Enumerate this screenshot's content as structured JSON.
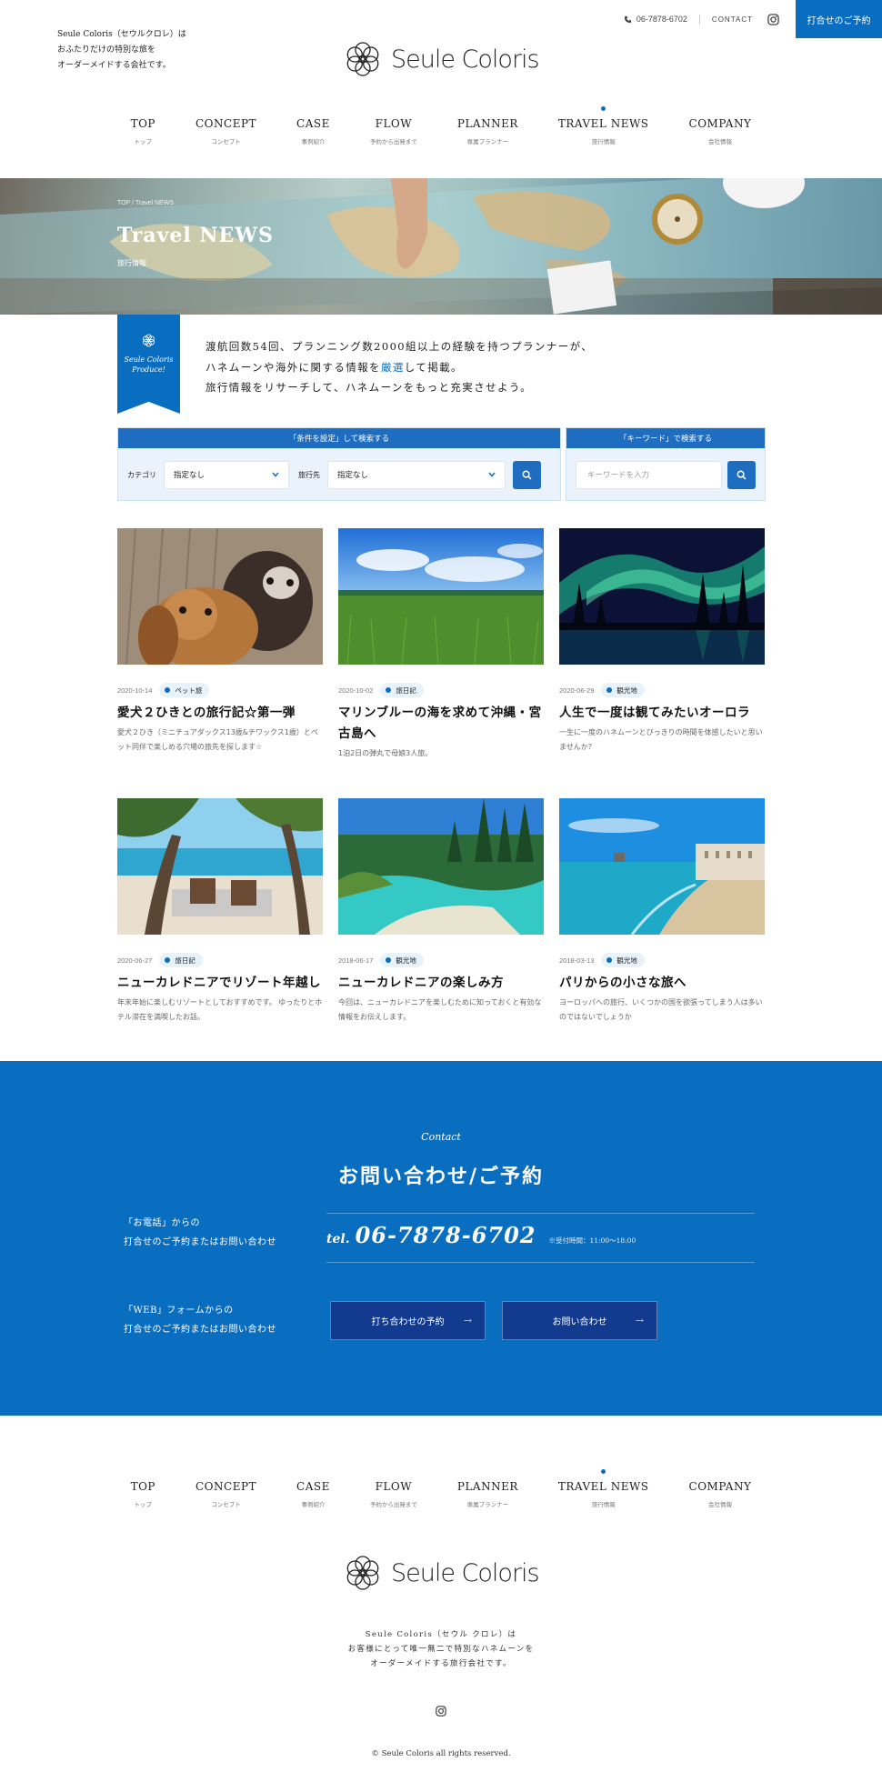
{
  "header": {
    "tagline": [
      "Seule Coloris（セウルクロレ）は",
      "おふたりだけの特別な旅を",
      "オーダーメイドする会社です。"
    ],
    "logo_text": "Seule Coloris",
    "phone": "06-7878-6702",
    "contact_label": "CONTACT",
    "reserve_label": "打合せのご予約"
  },
  "nav": [
    {
      "en": "TOP",
      "jp": "トップ"
    },
    {
      "en": "CONCEPT",
      "jp": "コンセプト"
    },
    {
      "en": "CASE",
      "jp": "事例紹介"
    },
    {
      "en": "FLOW",
      "jp": "予約から出発まで"
    },
    {
      "en": "PLANNER",
      "jp": "専属プランナー"
    },
    {
      "en": "TRAVEL NEWS",
      "jp": "旅行情報",
      "active": true
    },
    {
      "en": "COMPANY",
      "jp": "会社情報"
    }
  ],
  "hero": {
    "breadcrumb": "TOP / Travel NEWS",
    "title": "Travel NEWS",
    "subtitle": "旅行情報"
  },
  "intro": {
    "ribbon": [
      "Seule Coloris",
      "Produce!"
    ],
    "line1": "渡航回数54回、プランニング数2000組以上の経験を持つプランナーが、",
    "line2_a": "ハネムーンや海外に関する情報を",
    "line2_hl": "厳選",
    "line2_b": "して掲載。",
    "line3": "旅行情報をリサーチして、ハネムーンをもっと充実させよう。"
  },
  "search": {
    "cond_heading": "「条件を設定」して検索する",
    "category_label": "カテゴリ",
    "category_value": "指定なし",
    "destination_label": "旅行先",
    "destination_value": "指定なし",
    "keyword_heading": "「キーワード」で検索する",
    "keyword_placeholder": "キーワードを入力"
  },
  "articles": [
    {
      "date": "2020-10-14",
      "tag": "ペット旅",
      "title": "愛犬２ひきとの旅行記☆第一弾",
      "desc": "愛犬２ひき（ミニチュアダックス13歳&チワックス1歳）とペット同伴で楽しめる穴場の旅先を探します☆",
      "image": "dogs"
    },
    {
      "date": "2020-10-02",
      "tag": "旅日記",
      "title": "マリンブルーの海を求めて沖縄・宮古島へ",
      "desc": "1泊2日の弾丸で母娘3人旅。",
      "image": "field"
    },
    {
      "date": "2020-06-29",
      "tag": "観光地",
      "title": "人生で一度は観てみたいオーロラ",
      "desc": "一生に一度のハネムーンとびっきりの時間を体感したいと思いませんか？",
      "image": "aurora"
    },
    {
      "date": "2020-06-27",
      "tag": "旅日記",
      "title": "ニューカレドニアでリゾート年越し",
      "desc": "年末年始に楽しむリゾートとしておすすめです。 ゆったりとホテル滞在を満喫したお話。",
      "image": "beach-cafe"
    },
    {
      "date": "2018-06-17",
      "tag": "観光地",
      "title": "ニューカレドニアの楽しみ方",
      "desc": "今回は、ニューカレドニアを楽しむために知っておくと有効な情報をお伝えします。",
      "image": "lagoon"
    },
    {
      "date": "2018-03-13",
      "tag": "観光地",
      "title": "パリからの小さな旅へ",
      "desc": "ヨーロッパへの旅行、いくつかの国を欲張ってしまう人は多いのではないでしょうか",
      "image": "coast"
    }
  ],
  "contact": {
    "script": "Contact",
    "title": "お問い合わせ/ご予約",
    "phone_label": [
      "「お電話」からの",
      "打合せのご予約またはお問い合わせ"
    ],
    "tel_prefix": "tel.",
    "tel_number": "06-7878-6702",
    "hours": "※受付時間：11:00～18:00",
    "web_label": [
      "「WEB」フォームからの",
      "打合せのご予約またはお問い合わせ"
    ],
    "btn_reserve": "打ち合わせの予約",
    "btn_inquiry": "お問い合わせ",
    "arrow": "→"
  },
  "footer": {
    "logo_text": "Seule Coloris",
    "desc": [
      "Seule Coloris（セウル クロレ）は",
      "お客様にとって唯一無二で特別なハネムーンを",
      "オーダーメイドする旅行会社です。"
    ],
    "copyright": "© Seule Coloris all rights reserved."
  },
  "colors": {
    "brand": "#0a6ec0",
    "navy_button": "#123a8f",
    "search_tint": "#eaf3fb"
  },
  "icons": [
    "phone-icon",
    "instagram-icon",
    "chevron-down-icon",
    "search-icon",
    "flower-logo-icon",
    "arrow-right-icon"
  ]
}
